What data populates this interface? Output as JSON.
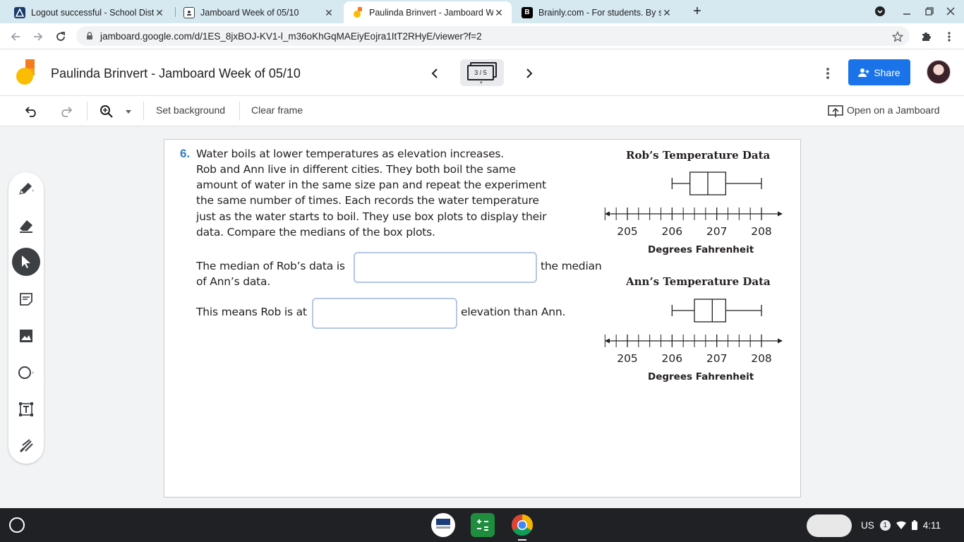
{
  "browser": {
    "tabs": [
      {
        "title": "Logout successful - School Distri",
        "favicon": "school-portal-icon",
        "color": "#1a3a6b"
      },
      {
        "title": "Jamboard Week of 05/10",
        "favicon": "classroom-icon",
        "color": "#3c4043"
      },
      {
        "title": "Paulinda Brinvert - Jamboard W",
        "favicon": "jamboard-icon",
        "color": "#f4b400",
        "active": true
      },
      {
        "title": "Brainly.com - For students. By st",
        "favicon": "brainly-icon",
        "color": "#000000"
      }
    ],
    "url": "jamboard.google.com/d/1ES_8jxBOJ-KV1-l_m36oKhGqMAEiyEojra1ItT2RHyE/viewer?f=2"
  },
  "header": {
    "title": "Paulinda Brinvert - Jamboard Week of 05/10",
    "frame_counter": "3 / 5",
    "share_label": "Share",
    "brand_color": "#1a73e8"
  },
  "toolbar": {
    "set_background": "Set background",
    "clear_frame": "Clear frame",
    "open_on_jamboard": "Open on a Jamboard"
  },
  "rail": {
    "tools": [
      "pen-icon",
      "eraser-icon",
      "select-icon",
      "sticky-note-icon",
      "image-icon",
      "circle-shape-icon",
      "text-box-icon",
      "laser-icon"
    ],
    "selected": "select-icon"
  },
  "question": {
    "number": "6.",
    "lines": [
      "Water boils at lower temperatures as elevation increases.",
      "Rob and Ann live in different cities. They both boil the same",
      "amount of water in the same size pan and repeat the experiment",
      "the same number of times. Each records the water temperature",
      "just as the water starts to boil. They use box plots to display their",
      "data. Compare the medians of the box plots."
    ],
    "sentence1_start": "The median of Rob’s data is",
    "sentence1_end": "the median",
    "sentence1_cont": "of Ann’s data.",
    "sentence2_start": "This means Rob is at",
    "sentence2_end": "elevation than Ann.",
    "answer1": "",
    "answer2": ""
  },
  "chart_data": [
    {
      "type": "boxplot",
      "title": "Rob’s Temperature Data",
      "xlabel": "Degrees Fahrenheit",
      "tick_labels": [
        "205",
        "206",
        "207",
        "208"
      ],
      "xlim": [
        205,
        208
      ],
      "minor_tick_step": 0.25,
      "min": 206.0,
      "q1": 206.4,
      "median": 206.8,
      "q3": 207.2,
      "max": 208.0
    },
    {
      "type": "boxplot",
      "title": "Ann’s Temperature Data",
      "xlabel": "Degrees Fahrenheit",
      "tick_labels": [
        "205",
        "206",
        "207",
        "208"
      ],
      "xlim": [
        205,
        208
      ],
      "minor_tick_step": 0.25,
      "min": 206.0,
      "q1": 206.5,
      "median": 206.9,
      "q3": 207.2,
      "max": 208.0
    }
  ],
  "taskbar": {
    "apps": [
      "pearson-techbook-icon",
      "calculator-app-icon",
      "chrome-icon"
    ],
    "locale": "US",
    "notification_count": "1",
    "time": "4:11"
  }
}
